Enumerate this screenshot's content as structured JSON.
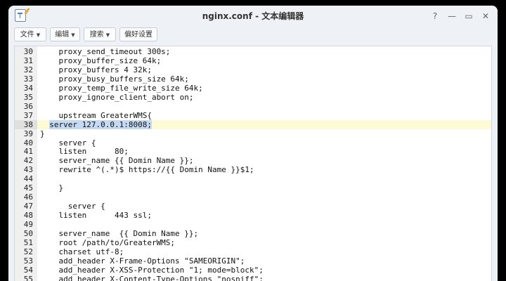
{
  "window": {
    "title": "nginx.conf - 文本编辑器",
    "controls": [
      "?",
      "—",
      "▭",
      "✕"
    ]
  },
  "toolbar": {
    "file_label": "文件",
    "edit_label": "编辑",
    "search_label": "搜索",
    "prefs_label": "偏好设置"
  },
  "editor": {
    "active_line": 38,
    "lines": [
      {
        "n": "30",
        "t": "    proxy_send_timeout 300s;"
      },
      {
        "n": "31",
        "t": "    proxy_buffer_size 64k;"
      },
      {
        "n": "32",
        "t": "    proxy_buffers 4 32k;"
      },
      {
        "n": "33",
        "t": "    proxy_busy_buffers_size 64k;"
      },
      {
        "n": "34",
        "t": "    proxy_temp_file_write_size 64k;"
      },
      {
        "n": "35",
        "t": "    proxy_ignore_client_abort on;"
      },
      {
        "n": "36",
        "t": ""
      },
      {
        "n": "37",
        "t": "    upstream GreaterWMS{"
      },
      {
        "n": "38",
        "t": "  server 127.0.0.1:8008;"
      },
      {
        "n": "39",
        "t": "}"
      },
      {
        "n": "40",
        "t": "    server {"
      },
      {
        "n": "41",
        "t": "    listen      80;"
      },
      {
        "n": "42",
        "t": "    server_name {{ Domin Name }};"
      },
      {
        "n": "43",
        "t": "    rewrite ^(.*)$ https://{{ Domin Name }}$1;"
      },
      {
        "n": "44",
        "t": ""
      },
      {
        "n": "45",
        "t": "    }"
      },
      {
        "n": "46",
        "t": ""
      },
      {
        "n": "47",
        "t": "      server {"
      },
      {
        "n": "48",
        "t": "    listen      443 ssl;"
      },
      {
        "n": "49",
        "t": ""
      },
      {
        "n": "50",
        "t": "    server_name  {{ Domin Name }};"
      },
      {
        "n": "51",
        "t": "    root /path/to/GreaterWMS;"
      },
      {
        "n": "52",
        "t": "    charset utf-8;"
      },
      {
        "n": "53",
        "t": "    add_header X-Frame-Options \"SAMEORIGIN\";"
      },
      {
        "n": "54",
        "t": "    add_header X-XSS-Protection \"1; mode=block\";"
      },
      {
        "n": "55",
        "t": "    add_header X-Content-Type-Options \"nosniff\";"
      }
    ],
    "selection": {
      "line_index": 8,
      "prefix": "  ",
      "selected": "server 127.0.0.1:8008;"
    }
  }
}
